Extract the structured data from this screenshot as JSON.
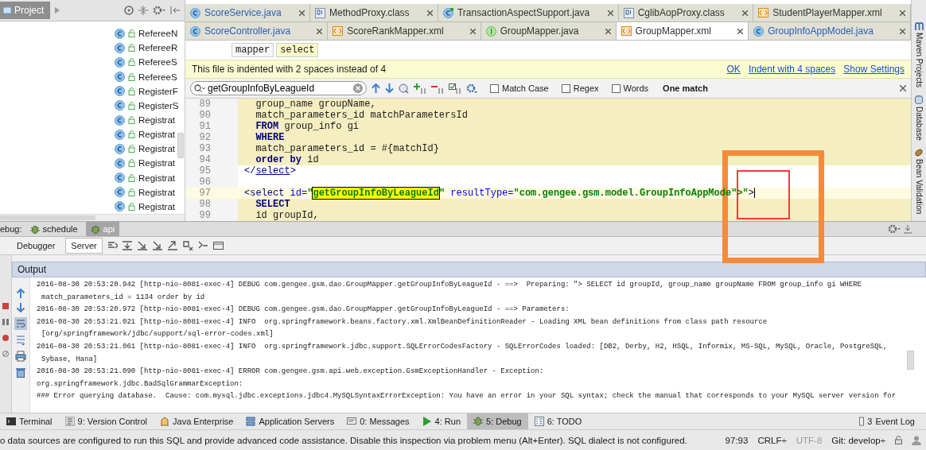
{
  "project_panel": {
    "title": "Project",
    "items": [
      {
        "label": "RefereeN"
      },
      {
        "label": "RefereeR"
      },
      {
        "label": "RefereeS"
      },
      {
        "label": "RefereeS"
      },
      {
        "label": "RegisterF"
      },
      {
        "label": "RegisterS"
      },
      {
        "label": "Registrat"
      },
      {
        "label": "Registrat"
      },
      {
        "label": "Registrat"
      },
      {
        "label": "Registrat"
      },
      {
        "label": "Registrat"
      },
      {
        "label": "Registrat"
      },
      {
        "label": "Registrat"
      }
    ]
  },
  "editor_tabs": [
    [
      {
        "label": "ScoreService.java",
        "kind": "class",
        "selected": false
      },
      {
        "label": "MethodProxy.class",
        "kind": "compiled",
        "selected": false
      },
      {
        "label": "TransactionAspectSupport.java",
        "kind": "aspect",
        "selected": false
      },
      {
        "label": "CglibAopProxy.class",
        "kind": "compiled",
        "selected": false
      },
      {
        "label": "StudentPlayerMapper.xml",
        "kind": "xml",
        "selected": false
      }
    ],
    [
      {
        "label": "ScoreController.java",
        "kind": "class",
        "selected": false
      },
      {
        "label": "ScoreRankMapper.xml",
        "kind": "xml",
        "selected": false
      },
      {
        "label": "GroupMapper.java",
        "kind": "interface",
        "selected": false
      },
      {
        "label": "GroupMapper.xml",
        "kind": "xml",
        "selected": true
      },
      {
        "label": "GroupInfoAppModel.java",
        "kind": "class",
        "selected": false
      }
    ]
  ],
  "breadcrumbs": [
    "mapper",
    "select"
  ],
  "notification": {
    "text": "This file is indented with 2 spaces instead of 4",
    "links": [
      "OK",
      "Indent with 4 spaces",
      "Show Settings"
    ]
  },
  "find_bar": {
    "value": "getGroupInfoByLeagueId",
    "options": [
      {
        "label": "Match Case",
        "checked": false
      },
      {
        "label": "Regex",
        "checked": false
      },
      {
        "label": "Words",
        "checked": false
      }
    ],
    "result": "One match"
  },
  "code": [
    {
      "number": "89",
      "kind": "sql",
      "tokens": [
        {
          "text": "  group_name groupName,",
          "kind": "plain"
        }
      ]
    },
    {
      "number": "90",
      "kind": "sql",
      "tokens": [
        {
          "text": "  match_parameters_id matchParametersId",
          "kind": "plain"
        }
      ]
    },
    {
      "number": "91",
      "kind": "sql",
      "tokens": [
        {
          "text": "  FROM",
          "kind": "keyword"
        },
        {
          "text": " group_info gi",
          "kind": "plain"
        }
      ]
    },
    {
      "number": "92",
      "kind": "sql",
      "tokens": [
        {
          "text": "  WHERE",
          "kind": "keyword"
        }
      ]
    },
    {
      "number": "93",
      "kind": "sql",
      "tokens": [
        {
          "text": "  match_parameters_id = #{matchId}",
          "kind": "plain"
        }
      ]
    },
    {
      "number": "94",
      "kind": "sql",
      "tokens": [
        {
          "text": "  order by",
          "kind": "keyword"
        },
        {
          "text": " id",
          "kind": "plain"
        }
      ]
    },
    {
      "number": "95",
      "kind": "xml",
      "tokens": [
        {
          "text": "</",
          "kind": "tag"
        },
        {
          "text": "select",
          "kind": "tagname"
        },
        {
          "text": ">",
          "kind": "tag"
        }
      ]
    },
    {
      "number": "96",
      "kind": "xml"
    },
    {
      "number": "97",
      "kind": "current",
      "tokens": [
        {
          "text": "<select",
          "kind": "tag"
        },
        {
          "text": " id=",
          "kind": "attr"
        },
        {
          "text": "\"",
          "kind": "string"
        },
        {
          "text": "getGroupInfoByLeagueId",
          "kind": "match"
        },
        {
          "text": "\"",
          "kind": "string"
        },
        {
          "text": " resultType=",
          "kind": "attr"
        },
        {
          "text": "\"com.gengee.gsm.model.GroupInfoAppMode\">\"",
          "kind": "string"
        },
        {
          "text": ">",
          "kind": "tag"
        }
      ]
    },
    {
      "number": "98",
      "kind": "sql",
      "tokens": [
        {
          "text": "  SELECT",
          "kind": "keyword"
        }
      ]
    },
    {
      "number": "99",
      "kind": "sql",
      "tokens": [
        {
          "text": "  id groupId,",
          "kind": "plain"
        }
      ]
    }
  ],
  "right_sidebar": [
    "Maven Projects",
    "Database",
    "Bean Validation"
  ],
  "debug_panel": {
    "label": "ebug:",
    "sessions": [
      {
        "label": "schedule",
        "selected": false
      },
      {
        "label": "api",
        "selected": true
      }
    ],
    "tabs": [
      {
        "label": "Debugger",
        "selected": false
      },
      {
        "label": "Server",
        "selected": true
      }
    ],
    "output_title": "Output",
    "log": [
      {
        "text": "2016-08-30 20:53:20.942 [http-nio-8081-exec-4] DEBUG com.gengee.gsm.dao.GroupMapper.getGroupInfoByLeagueId - ==>  Preparing: \"> SELECT id groupId, group_name groupName FROM group_info gi WHERE",
        "kind": "entry"
      },
      {
        "text": "match_parameters_id = 1134 order by id",
        "kind": "continuation"
      },
      {
        "text": "2016-08-30 20:53:20.972 [http-nio-8081-exec-4] DEBUG com.gengee.gsm.dao.GroupMapper.getGroupInfoByLeagueId - ==> Parameters:",
        "kind": "entry"
      },
      {
        "text": "2016-08-30 20:53:21.021 [http-nio-8081-exec-4] INFO  org.springframework.beans.factory.xml.XmlBeanDefinitionReader - Loading XML bean definitions from class path resource",
        "kind": "entry"
      },
      {
        "text": "[org/springframework/jdbc/support/sql-error-codes.xml]",
        "kind": "continuation"
      },
      {
        "text": "2016-08-30 20:53:21.061 [http-nio-8081-exec-4] INFO  org.springframework.jdbc.support.SQLErrorCodesFactory - SQLErrorCodes loaded: [DB2, Derby, H2, HSQL, Informix, MS-SQL, MySQL, Oracle, PostgreSQL,",
        "kind": "entry"
      },
      {
        "text": "Sybase, Hana]",
        "kind": "continuation"
      },
      {
        "text": "2016-08-30 20:53:21.090 [http-nio-8081-exec-4] ERROR com.gengee.gsm.api.web.exception.GsmExceptionHandler - Exception:",
        "kind": "entry"
      },
      {
        "text": "org.springframework.jdbc.BadSqlGrammarException:",
        "kind": "entry"
      },
      {
        "text": "### Error querying database.  Cause: com.mysql.jdbc.exceptions.jdbc4.MySQLSyntaxErrorException: You have an error in your SQL syntax; check the manual that corresponds to your MySQL server version for",
        "kind": "entry"
      }
    ]
  },
  "tool_windows": [
    {
      "label": "Terminal",
      "kind": "terminal",
      "selected": false
    },
    {
      "label": "9: Version Control",
      "kind": "vcs",
      "selected": false
    },
    {
      "label": "Java Enterprise",
      "kind": "enterprise",
      "selected": false
    },
    {
      "label": "Application Servers",
      "kind": "servers",
      "selected": false
    },
    {
      "label": "0: Messages",
      "kind": "messages",
      "selected": false
    },
    {
      "label": "4: Run",
      "kind": "run",
      "selected": false
    },
    {
      "label": "5: Debug",
      "kind": "debug",
      "selected": true
    },
    {
      "label": "6: TODO",
      "kind": "todo",
      "selected": false
    }
  ],
  "event_log": {
    "badge": "3",
    "label": "Event Log"
  },
  "status_bar": {
    "message": "o data sources are configured to run this SQL and provide advanced code assistance. Disable this inspection via problem menu (Alt+Enter). SQL dialect is not configured.",
    "position": "97:93",
    "line_separator": "CRLF÷",
    "encoding": "UTF-8",
    "branch": "Git: develop÷"
  }
}
